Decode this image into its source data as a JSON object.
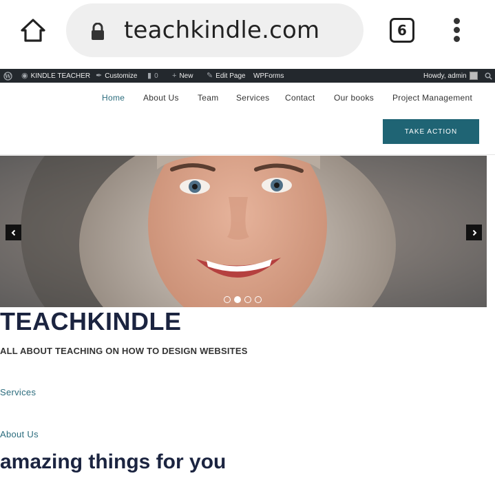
{
  "browser": {
    "url": "teachkindle.com",
    "tab_count": "6",
    "icons": {
      "home": "home-icon",
      "lock": "lock-icon",
      "menu": "more-vert-icon"
    }
  },
  "admin_bar": {
    "site_name": "KINDLE TEACHER",
    "customize": "Customize",
    "comments_count": "0",
    "new": "New",
    "edit_page": "Edit Page",
    "wpforms": "WPForms",
    "howdy": "Howdy, admin"
  },
  "nav": {
    "items": [
      "Home",
      "About Us",
      "Team",
      "Services",
      "Contact",
      "Our books",
      "Project Management"
    ],
    "active": "Home",
    "cta_label": "TAKE ACTION"
  },
  "slider": {
    "slide_count": 4,
    "active_slide": 2,
    "image_description_alt": "smiling woman"
  },
  "content": {
    "site_title": "TEACHKINDLE",
    "tagline": "ALL ABOUT TEACHING ON HOW TO DESIGN WEBSITES",
    "link_services": "Services",
    "link_about": "About Us",
    "heading": "amazing things for you"
  },
  "colors": {
    "accent": "#1f6474",
    "link": "#2a6b7c",
    "title": "#1b2440",
    "admin_bar": "#23282d"
  }
}
